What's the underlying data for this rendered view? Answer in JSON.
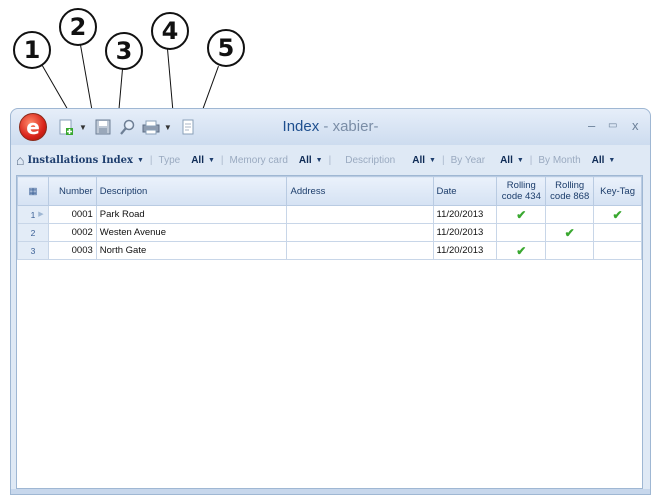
{
  "callouts": [
    "1",
    "2",
    "3",
    "4",
    "5"
  ],
  "window": {
    "app_orb_letter": "e",
    "title_main": "Index",
    "title_sep": " - ",
    "title_user": "xabier-",
    "minimize": "–",
    "maximize": "▭",
    "close": "x"
  },
  "toolbar": {
    "icons": [
      "new-record-icon",
      "save-icon",
      "search-icon",
      "print-icon",
      "report-icon"
    ]
  },
  "filters": {
    "index_label": "Installations Index",
    "type_label": "Type",
    "type_value": "All",
    "memory_card_label": "Memory card",
    "memory_card_value": "All",
    "description_label": "Description",
    "description_value": "All",
    "by_year_label": "By Year",
    "by_year_value": "All",
    "by_month_label": "By Month",
    "by_month_value": "All"
  },
  "table": {
    "headers": {
      "number": "Number",
      "description": "Description",
      "address": "Address",
      "date": "Date",
      "rolling434": "Rolling code 434",
      "rolling868": "Rolling code 868",
      "keytag": "Key-Tag"
    },
    "rows": [
      {
        "row": "1",
        "number": "0001",
        "description": "Park Road",
        "address": "",
        "date": "11/20/2013",
        "rolling434": true,
        "rolling868": false,
        "keytag": true
      },
      {
        "row": "2",
        "number": "0002",
        "description": "Westen Avenue",
        "address": "",
        "date": "11/20/2013",
        "rolling434": false,
        "rolling868": true,
        "keytag": false
      },
      {
        "row": "3",
        "number": "0003",
        "description": "North Gate",
        "address": "",
        "date": "11/20/2013",
        "rolling434": true,
        "rolling868": false,
        "keytag": false
      }
    ]
  },
  "colors": {
    "accent": "#1e4f8f",
    "check": "#3aa830",
    "orb": "#d8231a"
  }
}
